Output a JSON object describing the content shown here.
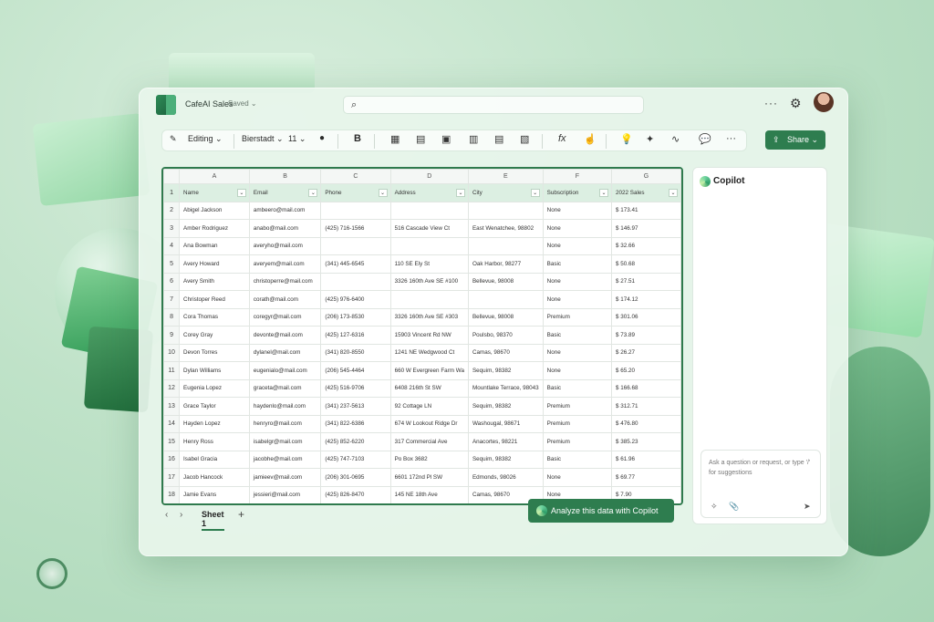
{
  "window": {
    "title": "CafeAI Sales",
    "status": "Saved ⌄"
  },
  "toolbar": {
    "editing_label": "Editing ⌄",
    "font_name": "Bierstadt ⌄",
    "font_size": "11 ⌄",
    "bold_label": "B",
    "more_label": "···",
    "share_label": "Share ⌄"
  },
  "sheet": {
    "columns": [
      "A",
      "B",
      "C",
      "D",
      "E",
      "F",
      "G"
    ],
    "headers": [
      "Name",
      "Email",
      "Phone",
      "Address",
      "City",
      "Subscription",
      "2022 Sales"
    ],
    "rows": [
      [
        "Abigel Jackson",
        "ambeero@mail.com",
        "",
        "",
        "",
        "None",
        "$ 173.41"
      ],
      [
        "Amber Rodriguez",
        "anabo@mail.com",
        "(425) 716-1566",
        "516 Cascade View Ct",
        "East Wenatchee, 98802",
        "None",
        "$ 146.97"
      ],
      [
        "Ana Bowman",
        "averyho@mail.com",
        "",
        "",
        "",
        "None",
        "$ 32.66"
      ],
      [
        "Avery Howard",
        "averyem@mail.com",
        "(341) 445-6545",
        "110 SE Ely St",
        "Oak Harbor, 98277",
        "Basic",
        "$ 50.68"
      ],
      [
        "Avery Smith",
        "christoperre@mail.com",
        "",
        "3326 160th Ave SE #100",
        "Bellevue, 98008",
        "None",
        "$ 27.51"
      ],
      [
        "Christoper Reed",
        "corath@mail.com",
        "(425) 976-6400",
        "",
        "",
        "None",
        "$ 174.12"
      ],
      [
        "Cora Thomas",
        "coregyr@mail.com",
        "(206) 173-8530",
        "3326 160th Ave SE #303",
        "Bellevue, 98008",
        "Premium",
        "$ 301.06"
      ],
      [
        "Corey Gray",
        "devonte@mail.com",
        "(425) 127-6316",
        "15903 Vincent Rd NW",
        "Poulsbo, 98370",
        "Basic",
        "$ 73.89"
      ],
      [
        "Devon Torres",
        "dylanel@mail.com",
        "(341) 820-8550",
        "1241 NE Wedgwood Ct",
        "Camas, 98670",
        "None",
        "$ 26.27"
      ],
      [
        "Dylan Williams",
        "eugenialo@mail.com",
        "(206) 545-4464",
        "660 W Evergreen Farm Wa",
        "Sequim, 98382",
        "None",
        "$ 65.20"
      ],
      [
        "Eugenia Lopez",
        "graceta@mail.com",
        "(425) 516-9706",
        "6408 216th St SW",
        "Mountlake Terrace, 98043",
        "Basic",
        "$ 166.68"
      ],
      [
        "Grace Taylor",
        "haydenlo@mail.com",
        "(341) 237-5613",
        "92 Cottage LN",
        "Sequim, 98382",
        "Premium",
        "$ 312.71"
      ],
      [
        "Hayden Lopez",
        "henryro@mail.com",
        "(341) 822-6386",
        "674 W Lookout Ridge Dr",
        "Washougal, 98671",
        "Premium",
        "$ 476.80"
      ],
      [
        "Henry Ross",
        "isabelgr@mail.com",
        "(425) 852-6220",
        "317 Commercial Ave",
        "Anacortes, 98221",
        "Premium",
        "$ 385.23"
      ],
      [
        "Isabel Gracia",
        "jacobhe@mail.com",
        "(425) 747-7103",
        "Po Box 3682",
        "Sequim, 98382",
        "Basic",
        "$ 61.96"
      ],
      [
        "Jacob Hancock",
        "jamieev@mail.com",
        "(206) 301-0695",
        "6601 172nd Pl SW",
        "Edmonds, 98026",
        "None",
        "$ 69.77"
      ],
      [
        "Jamie Evans",
        "jessieri@mail.com",
        "(425) 826-8470",
        "145 NE 18th Ave",
        "Camas, 98670",
        "None",
        "$ 7.90"
      ]
    ],
    "tab_label": "Sheet 1",
    "add_tab": "+",
    "nav_prev": "‹",
    "nav_next": "›"
  },
  "analyze_button": {
    "label": "Analyze this data with Copilot"
  },
  "copilot": {
    "title": "Copilot",
    "input_placeholder": "Ask a question or request, or type '/' for suggestions"
  },
  "colors": {
    "accent": "#2e7d4f",
    "header_fill": "#dcefe2"
  },
  "icons": [
    "search-icon",
    "pencil-icon",
    "gear-icon",
    "avatar",
    "share-icon",
    "copilot-icon",
    "attach-icon",
    "send-icon",
    "sparkle-icon"
  ]
}
